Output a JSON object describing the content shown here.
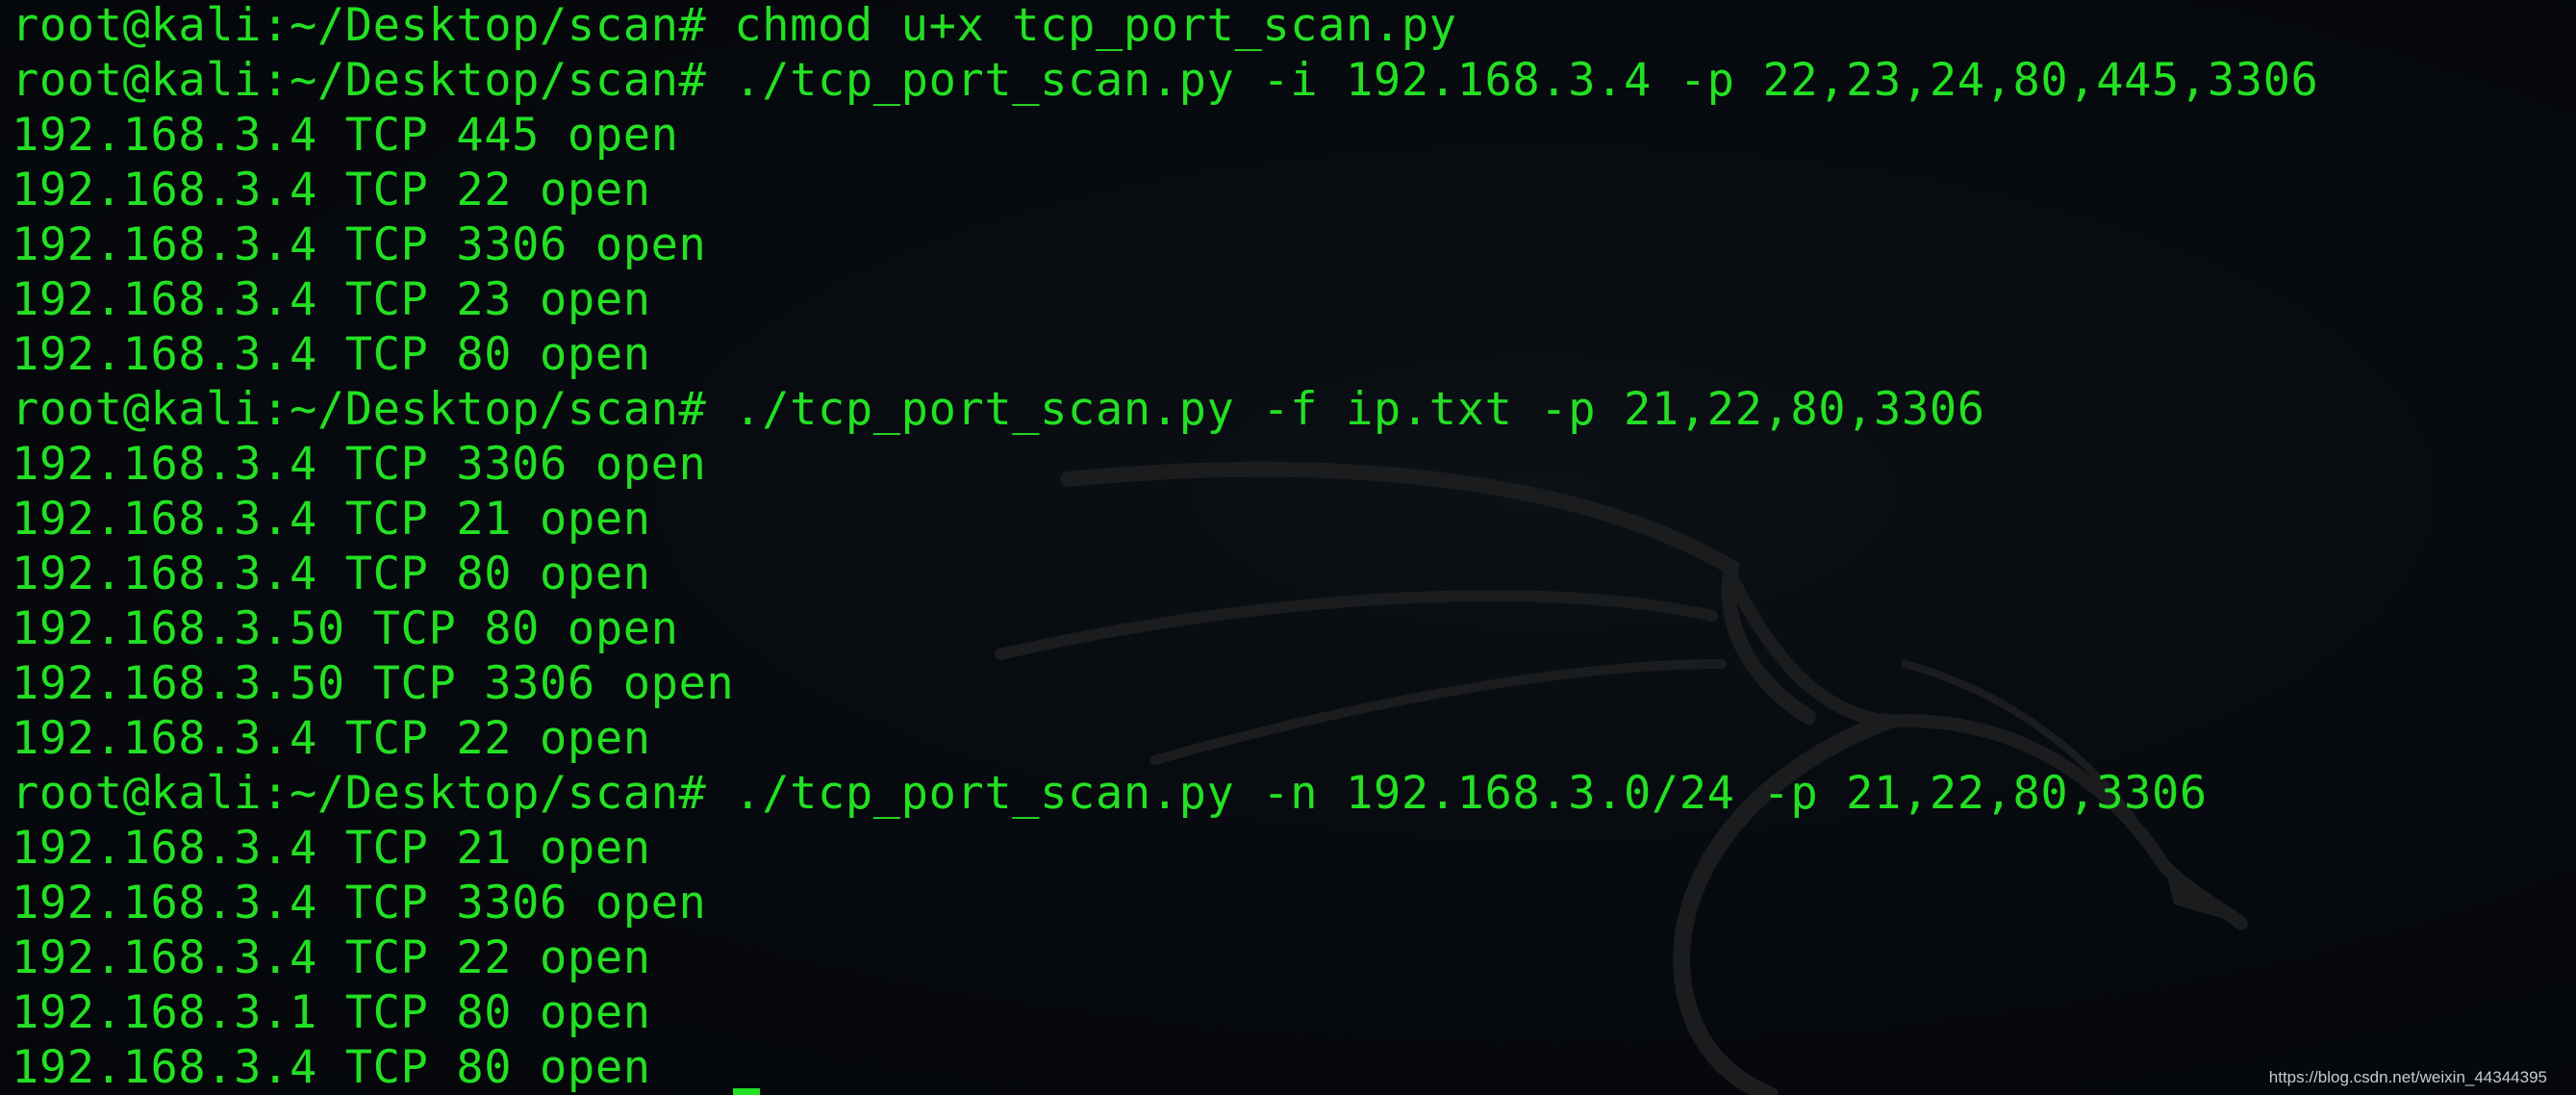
{
  "terminal": {
    "lines": [
      "root@kali:~/Desktop/scan# chmod u+x tcp_port_scan.py",
      "root@kali:~/Desktop/scan# ./tcp_port_scan.py -i 192.168.3.4 -p 22,23,24,80,445,3306",
      "192.168.3.4 TCP 445 open",
      "192.168.3.4 TCP 22 open",
      "192.168.3.4 TCP 3306 open",
      "192.168.3.4 TCP 23 open",
      "192.168.3.4 TCP 80 open",
      "root@kali:~/Desktop/scan# ./tcp_port_scan.py -f ip.txt -p 21,22,80,3306",
      "192.168.3.4 TCP 3306 open",
      "192.168.3.4 TCP 21 open",
      "192.168.3.4 TCP 80 open",
      "192.168.3.50 TCP 80 open",
      "192.168.3.50 TCP 3306 open",
      "192.168.3.4 TCP 22 open",
      "root@kali:~/Desktop/scan# ./tcp_port_scan.py -n 192.168.3.0/24 -p 21,22,80,3306",
      "192.168.3.4 TCP 21 open",
      "192.168.3.4 TCP 3306 open",
      "192.168.3.4 TCP 22 open",
      "192.168.3.1 TCP 80 open",
      "192.168.3.4 TCP 80 open"
    ],
    "text_color": "#23e023",
    "background_color": "#05080c"
  },
  "background_logo": "kali-dragon-icon",
  "watermark": "https://blog.csdn.net/weixin_44344395"
}
